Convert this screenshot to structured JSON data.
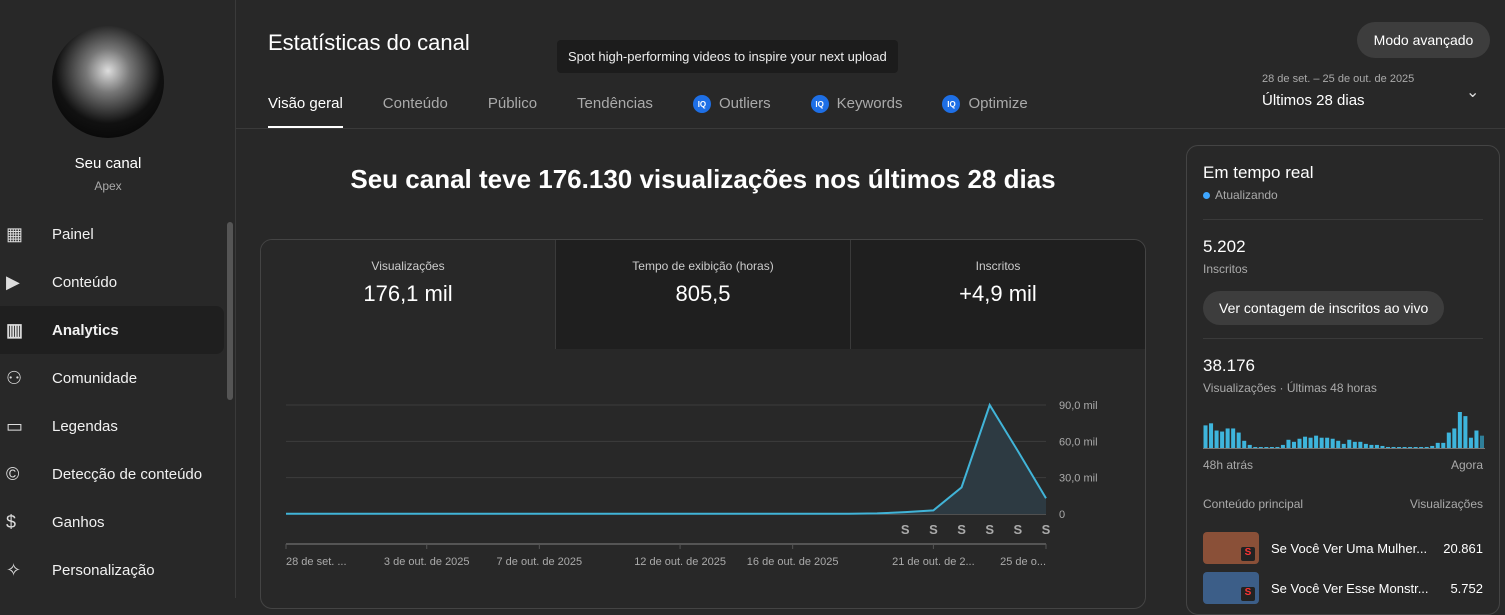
{
  "sidebar": {
    "channel_label": "Seu canal",
    "channel_handle": "Apex",
    "items": [
      {
        "label": "Painel",
        "icon": "dashboard-icon",
        "glyph": "▦"
      },
      {
        "label": "Conteúdo",
        "icon": "content-icon",
        "glyph": "▶"
      },
      {
        "label": "Analytics",
        "icon": "analytics-icon",
        "glyph": "▥"
      },
      {
        "label": "Comunidade",
        "icon": "community-icon",
        "glyph": "⚇"
      },
      {
        "label": "Legendas",
        "icon": "subtitles-icon",
        "glyph": "▭"
      },
      {
        "label": "Detecção de conteúdo",
        "icon": "copyright-icon",
        "glyph": "©"
      },
      {
        "label": "Ganhos",
        "icon": "earnings-icon",
        "glyph": "$"
      },
      {
        "label": "Personalização",
        "icon": "magic-wand-icon",
        "glyph": "✧"
      }
    ]
  },
  "header": {
    "title": "Estatísticas do canal",
    "tooltip": "Spot high-performing videos to inspire your next upload",
    "advanced_mode": "Modo avançado",
    "date_range": "28 de set. – 25 de out. de 2025",
    "period": "Últimos 28 dias",
    "tabs": [
      "Visão geral",
      "Conteúdo",
      "Público",
      "Tendências",
      "Outliers",
      "Keywords",
      "Optimize"
    ]
  },
  "main": {
    "headline": "Seu canal teve 176.130 visualizações nos últimos 28 dias",
    "metrics": [
      {
        "label": "Visualizações",
        "value": "176,1 mil"
      },
      {
        "label": "Tempo de exibição (horas)",
        "value": "805,5"
      },
      {
        "label": "Inscritos",
        "value": "+4,9 mil"
      }
    ]
  },
  "chart_data": {
    "type": "line",
    "series": [
      {
        "name": "Visualizações",
        "values": [
          200,
          200,
          200,
          200,
          200,
          200,
          200,
          200,
          200,
          200,
          200,
          200,
          200,
          200,
          200,
          200,
          200,
          200,
          200,
          200,
          200,
          500,
          1500,
          3000,
          22000,
          90000,
          52000,
          13000
        ]
      }
    ],
    "x_labels": [
      {
        "i": 0,
        "text": "28 de set. ..."
      },
      {
        "i": 5,
        "text": "3 de out. de 2025"
      },
      {
        "i": 9,
        "text": "7 de out. de 2025"
      },
      {
        "i": 14,
        "text": "12 de out. de 2025"
      },
      {
        "i": 18,
        "text": "16 de out. de 2025"
      },
      {
        "i": 23,
        "text": "21 de out. de 2..."
      },
      {
        "i": 27,
        "text": "25 de o..."
      }
    ],
    "y_ticks": [
      {
        "v": 0,
        "text": "0"
      },
      {
        "v": 30000,
        "text": "30,0 mil"
      },
      {
        "v": 60000,
        "text": "60,0 mil"
      },
      {
        "v": 90000,
        "text": "90,0 mil"
      }
    ],
    "ylim": [
      0,
      90000
    ],
    "shorts_marker_days": [
      22,
      23,
      24,
      25,
      26,
      27
    ],
    "color": "#41b4d8"
  },
  "realtime": {
    "title": "Em tempo real",
    "status": "Atualizando",
    "subs_value": "5.202",
    "subs_label": "Inscritos",
    "live_button": "Ver contagem de inscritos ao vivo",
    "views_value": "38.176",
    "views_label": "Visualizações · Últimas 48 horas",
    "start_label": "48h atrás",
    "end_label": "Agora",
    "hourly": [
      22,
      24,
      17,
      16,
      19,
      19,
      15,
      7,
      3,
      1,
      0,
      0,
      0,
      1,
      3,
      8,
      6,
      9,
      11,
      10,
      12,
      10,
      10,
      9,
      7,
      4,
      8,
      6,
      6,
      4,
      3,
      3,
      2,
      1,
      1,
      0,
      0,
      0,
      0,
      0,
      1,
      2,
      5,
      5,
      15,
      19,
      35,
      31,
      10,
      17,
      12
    ],
    "top_header": "Conteúdo principal",
    "top_views_header": "Visualizações",
    "top": [
      {
        "title": "Se Você Ver Uma Mulher...",
        "views": "20.861",
        "color": "#8a5038"
      },
      {
        "title": "Se Você Ver Esse Monstr...",
        "views": "5.752",
        "color": "#3c5e88"
      }
    ]
  }
}
